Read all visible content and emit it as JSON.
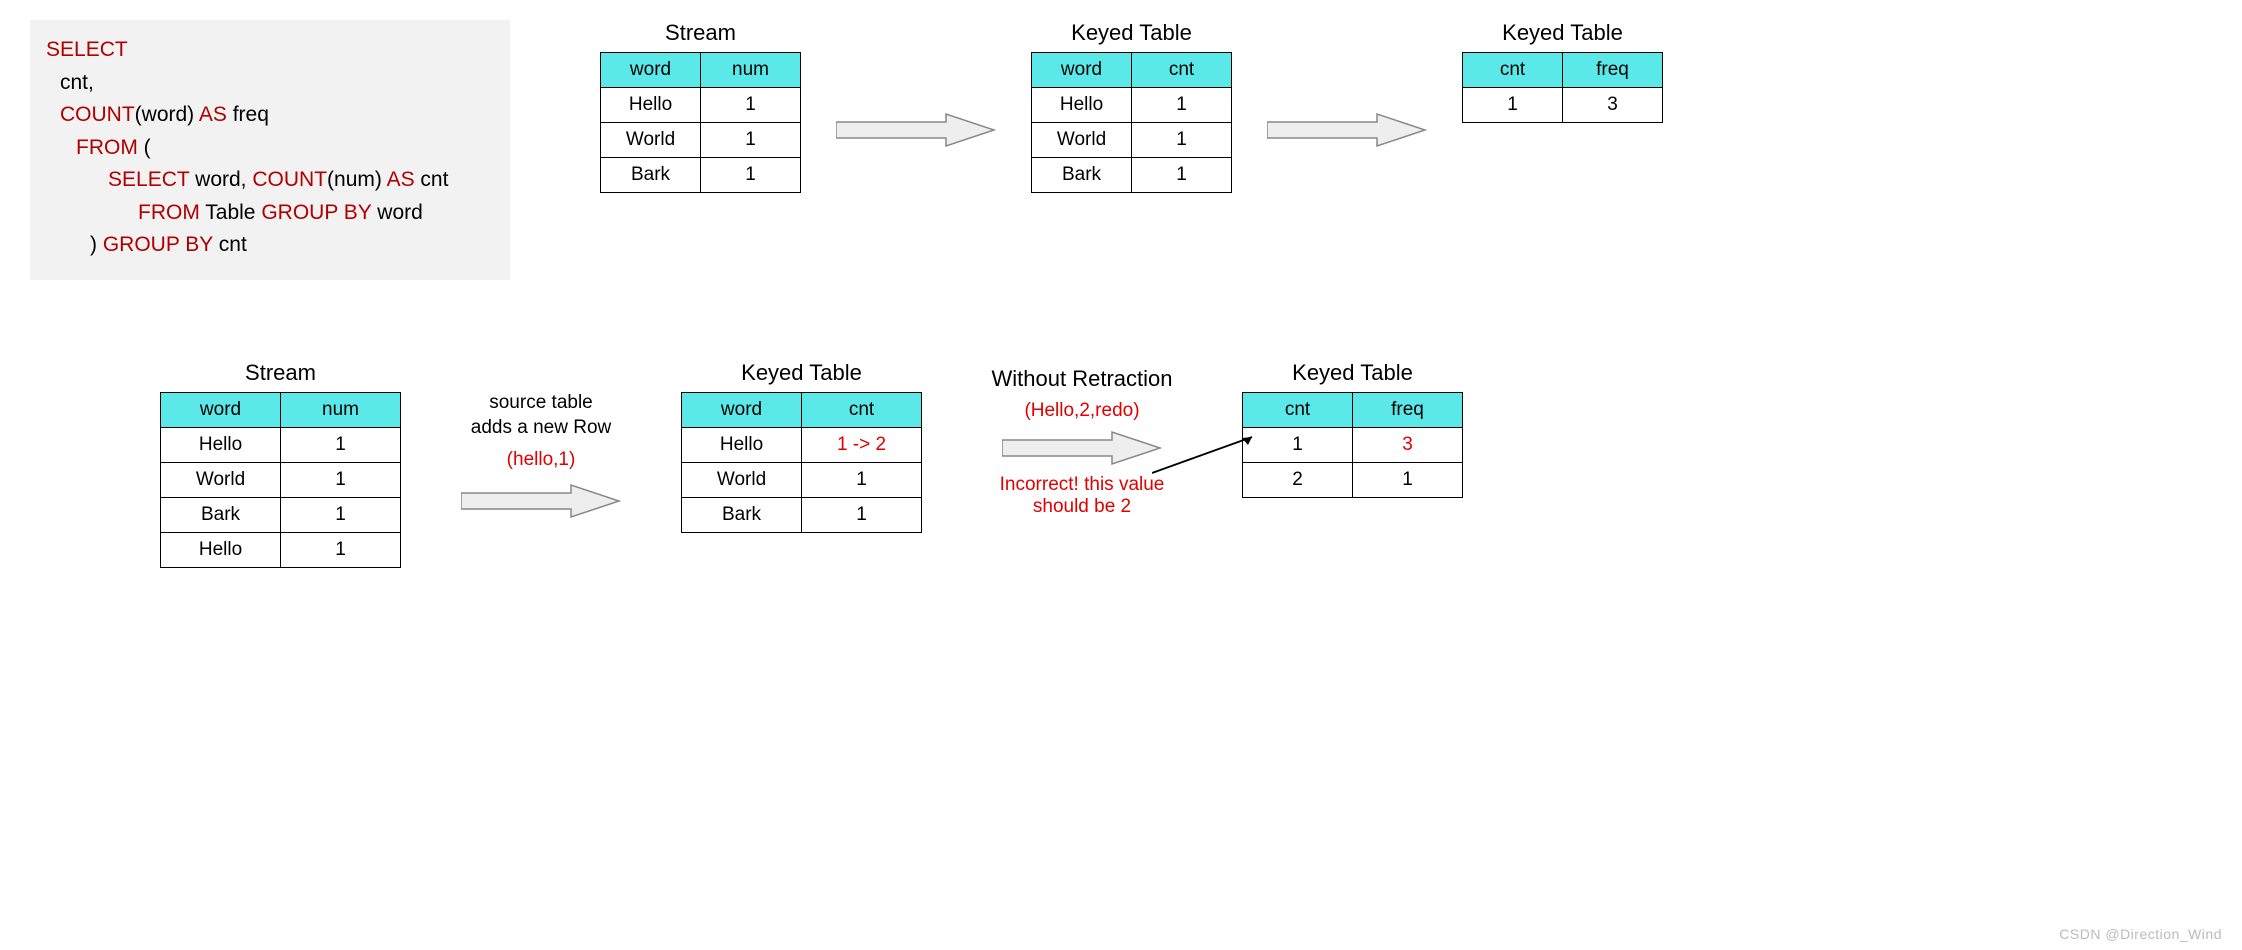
{
  "sql": {
    "l1_kw": "SELECT",
    "l2": "cnt,",
    "l3_kw1": "COUNT",
    "l3_p1": "(word)",
    "l3_kw2": "AS",
    "l3_p2": " freq",
    "l4_kw": "FROM",
    "l4_p": "  (",
    "l5_kw1": "SELECT",
    "l5_p1": " word,  ",
    "l5_kw2": "COUNT",
    "l5_p2": "(num)",
    "l5_kw3": "AS",
    "l5_p3": " cnt",
    "l6_kw1": "FROM",
    "l6_p1": " Table ",
    "l6_kw2": "GROUP BY",
    "l6_p2": " word",
    "l7_p1": ") ",
    "l7_kw": "GROUP BY",
    "l7_p2": " cnt"
  },
  "top": {
    "stream": {
      "title": "Stream",
      "h1": "word",
      "h2": "num",
      "rows": [
        [
          "Hello",
          "1"
        ],
        [
          "World",
          "1"
        ],
        [
          "Bark",
          "1"
        ]
      ]
    },
    "kt1": {
      "title": "Keyed Table",
      "h1": "word",
      "h2": "cnt",
      "rows": [
        [
          "Hello",
          "1"
        ],
        [
          "World",
          "1"
        ],
        [
          "Bark",
          "1"
        ]
      ]
    },
    "kt2": {
      "title": "Keyed Table",
      "h1": "cnt",
      "h2": "freq",
      "rows": [
        [
          "1",
          "3"
        ]
      ]
    }
  },
  "bottom": {
    "stream": {
      "title": "Stream",
      "h1": "word",
      "h2": "num",
      "rows": [
        [
          "Hello",
          "1"
        ],
        [
          "World",
          "1"
        ],
        [
          "Bark",
          "1"
        ]
      ],
      "redrow": [
        "Hello",
        "1"
      ]
    },
    "arrow1_note1": "source table",
    "arrow1_note2": "adds a new Row",
    "arrow1_red": "(hello,1)",
    "kt1": {
      "title": "Keyed Table",
      "h1": "word",
      "h2": "cnt",
      "rows": [
        [
          "Hello",
          "1 -> 2"
        ],
        [
          "World",
          "1"
        ],
        [
          "Bark",
          "1"
        ]
      ],
      "red_index": 0
    },
    "arrow2_title": "Without Retraction",
    "arrow2_red1": "(Hello,2,redo)",
    "arrow2_red2a": "Incorrect! this value",
    "arrow2_red2b": "should be 2",
    "kt2": {
      "title": "Keyed Table",
      "h1": "cnt",
      "h2": "freq",
      "rows": [
        [
          "1",
          "3"
        ],
        [
          "2",
          "1"
        ]
      ],
      "red_cell": "3"
    }
  },
  "watermark": "CSDN @Direction_Wind",
  "chart_data": [
    {
      "type": "table",
      "title": "Stream (initial)",
      "columns": [
        "word",
        "num"
      ],
      "rows": [
        [
          "Hello",
          1
        ],
        [
          "World",
          1
        ],
        [
          "Bark",
          1
        ]
      ]
    },
    {
      "type": "table",
      "title": "Keyed Table word->cnt (initial)",
      "columns": [
        "word",
        "cnt"
      ],
      "rows": [
        [
          "Hello",
          1
        ],
        [
          "World",
          1
        ],
        [
          "Bark",
          1
        ]
      ]
    },
    {
      "type": "table",
      "title": "Keyed Table cnt->freq (initial)",
      "columns": [
        "cnt",
        "freq"
      ],
      "rows": [
        [
          1,
          3
        ]
      ]
    },
    {
      "type": "table",
      "title": "Stream (after new row)",
      "columns": [
        "word",
        "num"
      ],
      "rows": [
        [
          "Hello",
          1
        ],
        [
          "World",
          1
        ],
        [
          "Bark",
          1
        ],
        [
          "Hello",
          1
        ]
      ],
      "annotation": "source table adds a new Row (hello,1)"
    },
    {
      "type": "table",
      "title": "Keyed Table word->cnt (after update)",
      "columns": [
        "word",
        "cnt"
      ],
      "rows": [
        [
          "Hello",
          "1 -> 2"
        ],
        [
          "World",
          1
        ],
        [
          "Bark",
          1
        ]
      ]
    },
    {
      "type": "table",
      "title": "Keyed Table cnt->freq (without retraction, incorrect)",
      "columns": [
        "cnt",
        "freq"
      ],
      "rows": [
        [
          1,
          3
        ],
        [
          2,
          1
        ]
      ],
      "annotation": "Without Retraction (Hello,2,redo) — Incorrect! this value should be 2"
    }
  ]
}
